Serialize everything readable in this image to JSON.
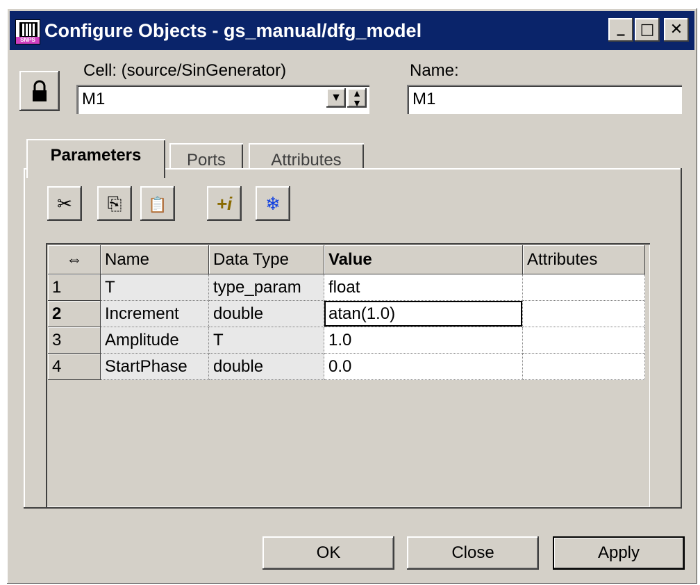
{
  "window": {
    "title": "Configure Objects - gs_manual/dfg_model",
    "icon_label": "SNPS",
    "controls": {
      "minimize": "_",
      "maximize": "□",
      "close": "✕"
    }
  },
  "cell": {
    "label": "Cell: (source/SinGenerator)",
    "value": "M1"
  },
  "name": {
    "label": "Name:",
    "value": "M1"
  },
  "tabs": [
    {
      "label": "Parameters",
      "active": true
    },
    {
      "label": "Ports",
      "active": false
    },
    {
      "label": "Attributes",
      "active": false
    }
  ],
  "toolbar": {
    "cut_icon": "✂",
    "copy_icon": "⎘",
    "paste_icon": "📋",
    "info_icon": "+i",
    "freeze_icon": "❄"
  },
  "table": {
    "resize_header": "⇔",
    "columns": [
      "Name",
      "Data Type",
      "Value",
      "Attributes"
    ],
    "rows": [
      {
        "num": "1",
        "name": "T",
        "type": "type_param",
        "value": "float",
        "attributes": ""
      },
      {
        "num": "2",
        "name": "Increment",
        "type": "double",
        "value": "atan(1.0)",
        "attributes": ""
      },
      {
        "num": "3",
        "name": "Amplitude",
        "type": "T",
        "value": "1.0",
        "attributes": ""
      },
      {
        "num": "4",
        "name": "StartPhase",
        "type": "double",
        "value": "0.0",
        "attributes": ""
      }
    ]
  },
  "buttons": {
    "ok": "OK",
    "close": "Close",
    "apply": "Apply"
  },
  "colors": {
    "titlebar": "#0a246a",
    "face": "#d4d0c8"
  }
}
